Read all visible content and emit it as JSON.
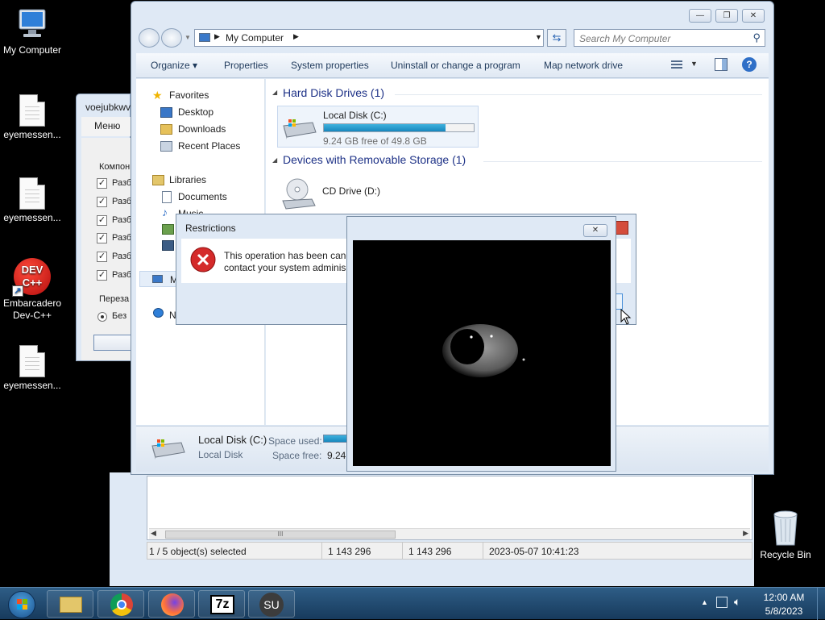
{
  "desktop": {
    "icons": [
      {
        "label": "My Computer"
      },
      {
        "label": "eyemessen..."
      },
      {
        "label": "eyemessen..."
      },
      {
        "label": "Embarcadero Dev-C++"
      },
      {
        "label": "eyemessen..."
      },
      {
        "label": "Recycle Bin"
      }
    ],
    "devcpp_badge": "DEV C++"
  },
  "explorer": {
    "caption": {
      "minimize": "—",
      "maximize": "❐",
      "close": "✕"
    },
    "address": "My Computer",
    "search_placeholder": "Search My Computer",
    "toolbar": {
      "organize": "Organize ▾",
      "properties": "Properties",
      "system_properties": "System properties",
      "uninstall": "Uninstall or change a program",
      "map_drive": "Map network drive"
    },
    "nav": {
      "favorites": "Favorites",
      "desktop": "Desktop",
      "downloads": "Downloads",
      "recent": "Recent Places",
      "libraries": "Libraries",
      "documents": "Documents",
      "music": "Music",
      "computer_partial": "M",
      "network_partial": "N"
    },
    "groups": {
      "hdd": "Hard Disk Drives (1)",
      "removable": "Devices with Removable Storage (1)"
    },
    "drives": {
      "c_name": "Local Disk (C:)",
      "c_free": "9.24 GB free of 49.8 GB",
      "c_used_fraction": 0.81,
      "d_name": "CD Drive (D:)"
    },
    "details": {
      "name": "Local Disk (C:)",
      "type": "Local Disk",
      "space_used_label": "Space used:",
      "space_free_label": "Space free:",
      "space_free_value": "9.24"
    }
  },
  "restrictions": {
    "title": "Restrictions",
    "message_line1": "This operation has been canc",
    "message_line2": "contact your system adminis"
  },
  "camera": {
    "close": "✕"
  },
  "russian_window": {
    "title": "voejubkwv",
    "menu": "Меню",
    "group": "Компон",
    "items": [
      "Разб",
      "Разб",
      "Разб",
      "Разб",
      "Разб",
      "Разб"
    ],
    "section2": "Переза",
    "radio": "Без"
  },
  "back_window": {
    "scroll_thumb": "III",
    "status": {
      "selected": "1 / 5 object(s) selected",
      "size1": "1 143 296",
      "size2": "1 143 296",
      "date": "2023-05-07 10:41:23"
    }
  },
  "taskbar": {
    "apps": [
      "Windows Explorer",
      "Google Chrome",
      "Firefox",
      "7-Zip",
      "SU"
    ],
    "sevenzip": "7z",
    "su": "SU",
    "time": "12:00 AM",
    "date": "5/8/2023"
  }
}
